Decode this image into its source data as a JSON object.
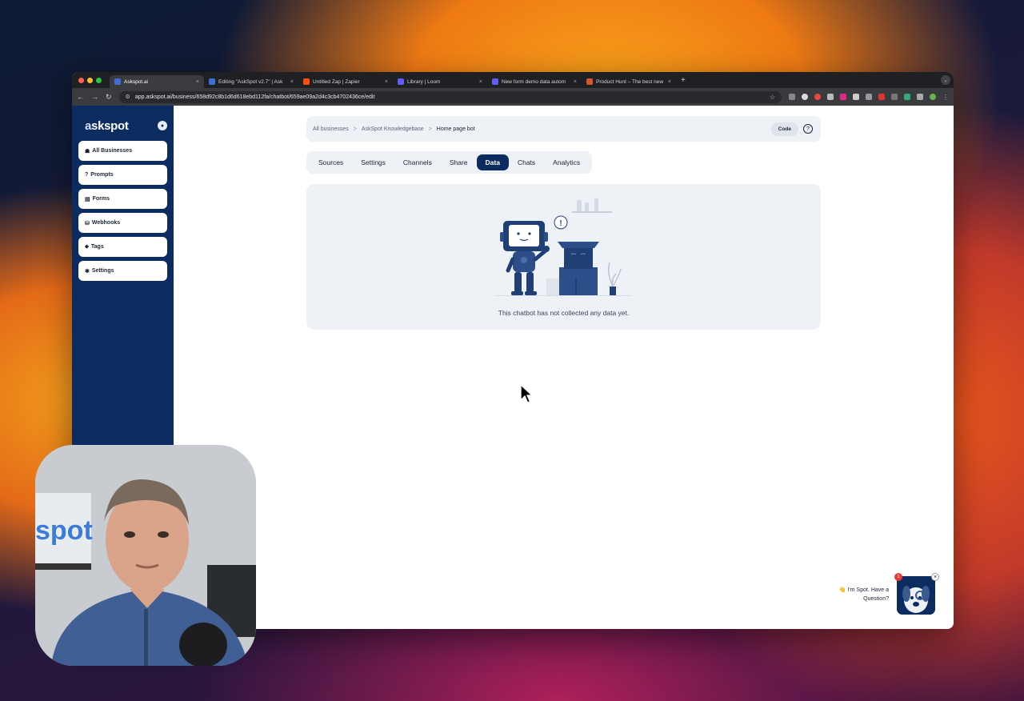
{
  "browser": {
    "tabs": [
      {
        "title": "Askspot.ai",
        "favicon_color": "#3d6fd6",
        "active": true
      },
      {
        "title": "Editing \"AskSpot v2.7\" | Ask",
        "favicon_color": "#3d6fd6",
        "active": false
      },
      {
        "title": "Untitled Zap | Zapier",
        "favicon_color": "#ff4f00",
        "active": false
      },
      {
        "title": "Library | Loom",
        "favicon_color": "#625df5",
        "active": false
      },
      {
        "title": "New form demo data autom",
        "favicon_color": "#625df5",
        "active": false
      },
      {
        "title": "Product Hunt – The best new",
        "favicon_color": "#da552f",
        "active": false
      }
    ],
    "new_tab_symbol": "+",
    "url": "app.askspot.ai/business/658d92c8b1d6d618ebd112fa/chatbot/659ae09a2d4c3cb4702436ce/edit"
  },
  "sidebar": {
    "logo": {
      "prefix": "a",
      "rest": "skspot"
    },
    "items": [
      {
        "icon": "☗",
        "label": "All Businesses"
      },
      {
        "icon": "?",
        "label": "Prompts"
      },
      {
        "icon": "▤",
        "label": "Forms"
      },
      {
        "icon": "⛁",
        "label": "Webhooks"
      },
      {
        "icon": "⬥",
        "label": "Tags"
      },
      {
        "icon": "✱",
        "label": "Settings"
      }
    ]
  },
  "breadcrumb": {
    "items": [
      "All businesses",
      "AskSpot Knowledgebase",
      "Home page bot"
    ],
    "separator": ">",
    "code_label": "Code",
    "help_symbol": "?"
  },
  "tabs": [
    {
      "label": "Sources",
      "active": false
    },
    {
      "label": "Settings",
      "active": false
    },
    {
      "label": "Channels",
      "active": false
    },
    {
      "label": "Share",
      "active": false
    },
    {
      "label": "Data",
      "active": true
    },
    {
      "label": "Chats",
      "active": false
    },
    {
      "label": "Analytics",
      "active": false
    }
  ],
  "empty_state": {
    "message": "This chatbot has not collected any data yet.",
    "alert_symbol": "!"
  },
  "chat_widget": {
    "greeting_line1": "👋 I'm Spot. Have a",
    "greeting_line2": "Question?",
    "badge_count": "1",
    "close_symbol": "×"
  },
  "colors": {
    "brand_navy": "#0c2b60",
    "panel_bg": "#eef2f7"
  }
}
